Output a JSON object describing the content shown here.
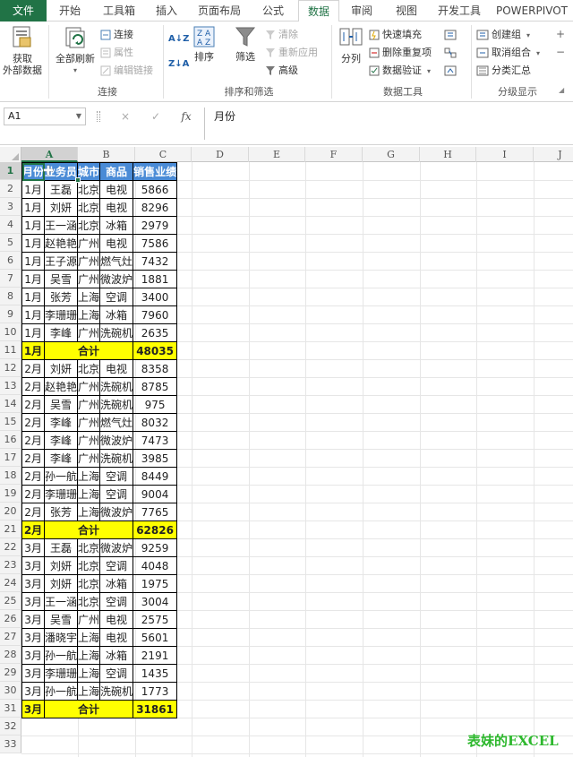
{
  "ribbon_tabs": [
    "文件",
    "开始",
    "工具箱",
    "插入",
    "页面布局",
    "公式",
    "数据",
    "审阅",
    "视图",
    "开发工具",
    "POWERPIVOT"
  ],
  "active_tab": "数据",
  "ribbon": {
    "get_external": "获取\n外部数据",
    "refresh_all": "全部刷新",
    "connections": "连接",
    "properties": "属性",
    "edit_links": "编辑链接",
    "group_connections": "连接",
    "sort_az": "A↓Z",
    "sort_za": "Z↓A",
    "sort": "排序",
    "filter": "筛选",
    "clear": "清除",
    "reapply": "重新应用",
    "advanced": "高级",
    "group_sort_filter": "排序和筛选",
    "text_to_columns": "分列",
    "flash_fill": "快速填充",
    "remove_duplicates": "删除重复项",
    "data_validation": "数据验证",
    "group_data_tools": "数据工具",
    "create_group": "创建组",
    "ungroup": "取消组合",
    "subtotal": "分类汇总",
    "group_outline": "分级显示"
  },
  "formula_bar": {
    "name_box": "A1",
    "cancel": "×",
    "enter": "✓",
    "fx": "fx",
    "content": "月份"
  },
  "columns": [
    "A",
    "B",
    "C",
    "D",
    "E",
    "F",
    "G",
    "H",
    "I",
    "J"
  ],
  "row_numbers": [
    "1",
    "2",
    "3",
    "4",
    "5",
    "6",
    "7",
    "8",
    "9",
    "10",
    "11",
    "12",
    "13",
    "14",
    "15",
    "16",
    "17",
    "18",
    "19",
    "20",
    "21",
    "22",
    "23",
    "24",
    "25",
    "26",
    "27",
    "28",
    "29",
    "30",
    "31",
    "32",
    "33"
  ],
  "table": {
    "header": [
      "月份",
      "业务员",
      "城市",
      "商品",
      "销售业绩"
    ],
    "rows": [
      {
        "type": "data",
        "cells": [
          "1月",
          "王磊",
          "北京",
          "电视",
          "5866"
        ]
      },
      {
        "type": "data",
        "cells": [
          "1月",
          "刘妍",
          "北京",
          "电视",
          "8296"
        ]
      },
      {
        "type": "data",
        "cells": [
          "1月",
          "王一涵",
          "北京",
          "冰箱",
          "2979"
        ]
      },
      {
        "type": "data",
        "cells": [
          "1月",
          "赵艳艳",
          "广州",
          "电视",
          "7586"
        ]
      },
      {
        "type": "data",
        "cells": [
          "1月",
          "王子源",
          "广州",
          "燃气灶",
          "7432"
        ]
      },
      {
        "type": "data",
        "cells": [
          "1月",
          "吴雪",
          "广州",
          "微波炉",
          "1881"
        ]
      },
      {
        "type": "data",
        "cells": [
          "1月",
          "张芳",
          "上海",
          "空调",
          "3400"
        ]
      },
      {
        "type": "data",
        "cells": [
          "1月",
          "李珊珊",
          "上海",
          "冰箱",
          "7960"
        ]
      },
      {
        "type": "data",
        "cells": [
          "1月",
          "李峰",
          "广州",
          "洗碗机",
          "2635"
        ]
      },
      {
        "type": "subtotal",
        "cells": [
          "1月",
          "合计",
          "48035"
        ]
      },
      {
        "type": "data",
        "cells": [
          "2月",
          "刘妍",
          "北京",
          "电视",
          "8358"
        ]
      },
      {
        "type": "data",
        "cells": [
          "2月",
          "赵艳艳",
          "广州",
          "洗碗机",
          "8785"
        ]
      },
      {
        "type": "data",
        "cells": [
          "2月",
          "吴雪",
          "广州",
          "洗碗机",
          "975"
        ]
      },
      {
        "type": "data",
        "cells": [
          "2月",
          "李峰",
          "广州",
          "燃气灶",
          "8032"
        ]
      },
      {
        "type": "data",
        "cells": [
          "2月",
          "李峰",
          "广州",
          "微波炉",
          "7473"
        ]
      },
      {
        "type": "data",
        "cells": [
          "2月",
          "李峰",
          "广州",
          "洗碗机",
          "3985"
        ]
      },
      {
        "type": "data",
        "cells": [
          "2月",
          "孙一航",
          "上海",
          "空调",
          "8449"
        ]
      },
      {
        "type": "data",
        "cells": [
          "2月",
          "李珊珊",
          "上海",
          "空调",
          "9004"
        ]
      },
      {
        "type": "data",
        "cells": [
          "2月",
          "张芳",
          "上海",
          "微波炉",
          "7765"
        ]
      },
      {
        "type": "subtotal",
        "cells": [
          "2月",
          "合计",
          "62826"
        ]
      },
      {
        "type": "data",
        "cells": [
          "3月",
          "王磊",
          "北京",
          "微波炉",
          "9259"
        ]
      },
      {
        "type": "data",
        "cells": [
          "3月",
          "刘妍",
          "北京",
          "空调",
          "4048"
        ]
      },
      {
        "type": "data",
        "cells": [
          "3月",
          "刘妍",
          "北京",
          "冰箱",
          "1975"
        ]
      },
      {
        "type": "data",
        "cells": [
          "3月",
          "王一涵",
          "北京",
          "空调",
          "3004"
        ]
      },
      {
        "type": "data",
        "cells": [
          "3月",
          "吴雪",
          "广州",
          "电视",
          "2575"
        ]
      },
      {
        "type": "data",
        "cells": [
          "3月",
          "潘晓宇",
          "上海",
          "电视",
          "5601"
        ]
      },
      {
        "type": "data",
        "cells": [
          "3月",
          "孙一航",
          "上海",
          "冰箱",
          "2191"
        ]
      },
      {
        "type": "data",
        "cells": [
          "3月",
          "李珊珊",
          "上海",
          "空调",
          "1435"
        ]
      },
      {
        "type": "data",
        "cells": [
          "3月",
          "孙一航",
          "上海",
          "洗碗机",
          "1773"
        ]
      },
      {
        "type": "subtotal",
        "cells": [
          "3月",
          "合计",
          "31861"
        ]
      }
    ]
  },
  "watermark": "表妹的EXCEL",
  "colors": {
    "excel_green": "#217346",
    "header_blue": "#4a8bd6",
    "subtotal_yellow": "#ffff00",
    "watermark_green": "#2eb82e"
  }
}
